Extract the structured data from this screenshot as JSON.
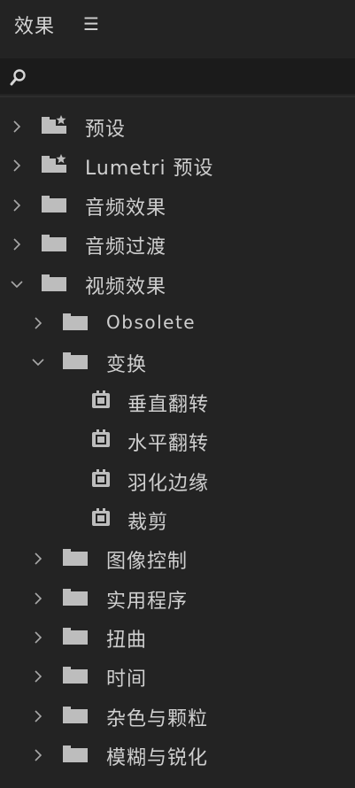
{
  "panel": {
    "title": "效果",
    "menu_glyph": "☰"
  },
  "search": {
    "value": "",
    "placeholder": "",
    "icon": "search-icon"
  },
  "tree": [
    {
      "label": "预设",
      "depth": 0,
      "type": "preset-folder",
      "expanded": false
    },
    {
      "label": "Lumetri 预设",
      "depth": 0,
      "type": "preset-folder",
      "expanded": false
    },
    {
      "label": "音频效果",
      "depth": 0,
      "type": "folder",
      "expanded": false
    },
    {
      "label": "音频过渡",
      "depth": 0,
      "type": "folder",
      "expanded": false
    },
    {
      "label": "视频效果",
      "depth": 0,
      "type": "folder",
      "expanded": true
    },
    {
      "label": "Obsolete",
      "depth": 1,
      "type": "folder",
      "expanded": false
    },
    {
      "label": "变换",
      "depth": 1,
      "type": "folder",
      "expanded": true
    },
    {
      "label": "垂直翻转",
      "depth": 2,
      "type": "effect"
    },
    {
      "label": "水平翻转",
      "depth": 2,
      "type": "effect"
    },
    {
      "label": "羽化边缘",
      "depth": 2,
      "type": "effect"
    },
    {
      "label": "裁剪",
      "depth": 2,
      "type": "effect"
    },
    {
      "label": "图像控制",
      "depth": 1,
      "type": "folder",
      "expanded": false
    },
    {
      "label": "实用程序",
      "depth": 1,
      "type": "folder",
      "expanded": false
    },
    {
      "label": "扭曲",
      "depth": 1,
      "type": "folder",
      "expanded": false
    },
    {
      "label": "时间",
      "depth": 1,
      "type": "folder",
      "expanded": false
    },
    {
      "label": "杂色与颗粒",
      "depth": 1,
      "type": "folder",
      "expanded": false
    },
    {
      "label": "模糊与锐化",
      "depth": 1,
      "type": "folder",
      "expanded": false
    }
  ],
  "colors": {
    "background": "#232323",
    "text": "#cfcfcf",
    "icon": "#bdbdbd",
    "search_bg": "#1b1b1b"
  }
}
